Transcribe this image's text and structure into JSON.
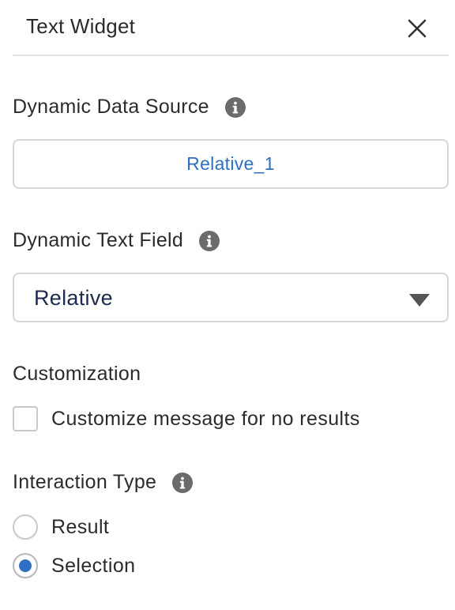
{
  "header": {
    "title": "Text Widget",
    "close_icon": "close-icon"
  },
  "dynamic_data_source": {
    "label": "Dynamic Data Source",
    "info_icon": "info-icon",
    "value": "Relative_1",
    "value_color": "#2f6fc3"
  },
  "dynamic_text_field": {
    "label": "Dynamic Text Field",
    "info_icon": "info-icon",
    "selected": "Relative",
    "caret_icon": "caret-down-icon"
  },
  "customization": {
    "label": "Customization",
    "checkbox_label": "Customize message for no results",
    "checked": false
  },
  "interaction_type": {
    "label": "Interaction Type",
    "info_icon": "info-icon",
    "options": [
      {
        "label": "Result",
        "checked": false
      },
      {
        "label": "Selection",
        "checked": true
      }
    ],
    "accent": "#2f6fc3"
  }
}
